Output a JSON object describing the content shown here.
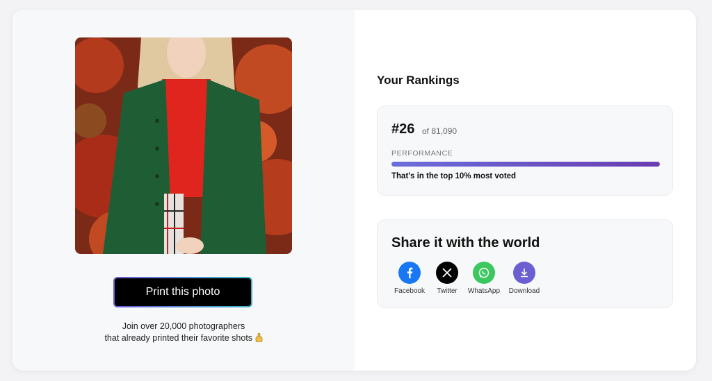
{
  "left": {
    "print_button": "Print this photo",
    "join_line1": "Join over 20,000 photographers",
    "join_line2": "that already printed their favorite shots"
  },
  "rankings": {
    "title": "Your Rankings",
    "rank": "#26",
    "of_total": "of 81,090",
    "performance_label": "PERFORMANCE",
    "performance_fill": 1.0,
    "summary": "That's in the top 10% most voted"
  },
  "share": {
    "title": "Share it with the world",
    "items": [
      {
        "label": "Facebook",
        "icon": "facebook-icon",
        "color": "#1877f2"
      },
      {
        "label": "Twitter",
        "icon": "x-icon",
        "color": "#000000"
      },
      {
        "label": "WhatsApp",
        "icon": "whatsapp-icon",
        "color": "#3cc85f"
      },
      {
        "label": "Download",
        "icon": "download-icon",
        "color": "#6b5fd1"
      }
    ]
  }
}
